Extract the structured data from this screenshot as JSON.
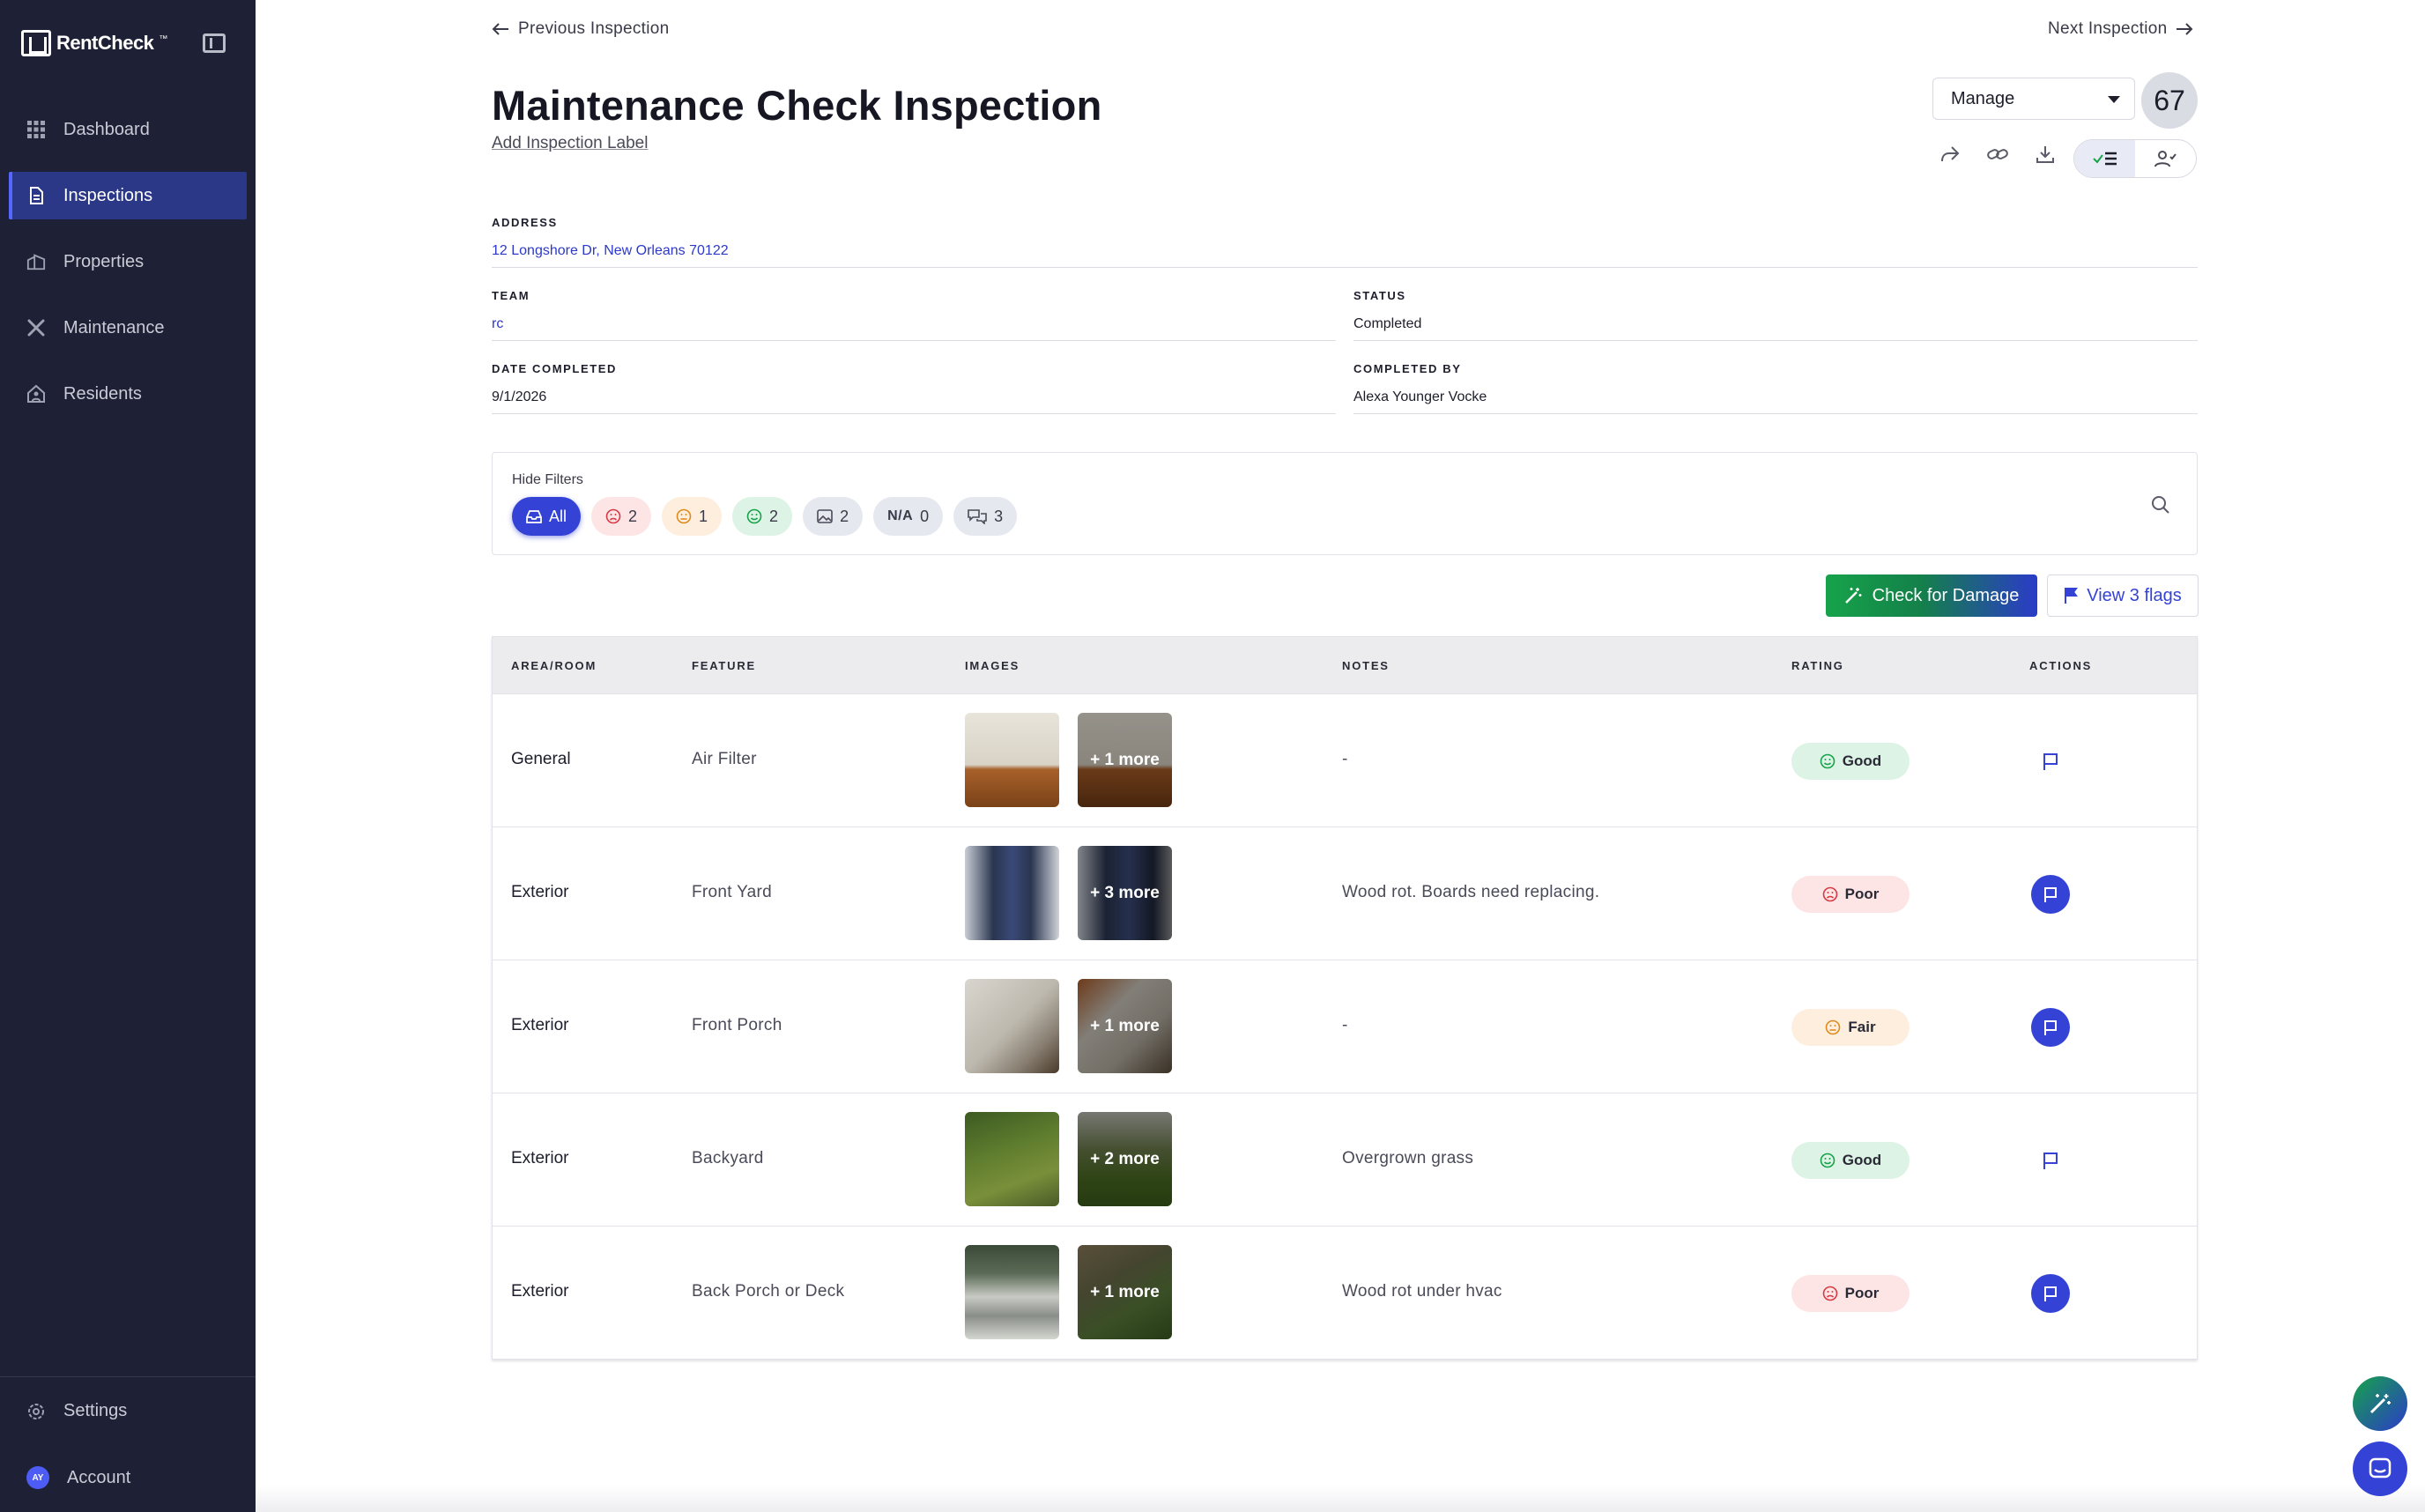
{
  "app": {
    "logo_text": "RentCheck",
    "logo_tm": "™"
  },
  "sidebar": {
    "items": [
      {
        "label": "Dashboard",
        "icon": "grid-icon",
        "active": false
      },
      {
        "label": "Inspections",
        "icon": "document-icon",
        "active": true
      },
      {
        "label": "Properties",
        "icon": "buildings-icon",
        "active": false
      },
      {
        "label": "Maintenance",
        "icon": "tools-icon",
        "active": false
      },
      {
        "label": "Residents",
        "icon": "house-person-icon",
        "active": false
      }
    ],
    "settings_label": "Settings",
    "account_label": "Account",
    "account_initials": "AY"
  },
  "header": {
    "previous_label": "Previous Inspection",
    "next_label": "Next Inspection",
    "title": "Maintenance Check Inspection",
    "add_label": "Add Inspection Label",
    "manage_label": "Manage",
    "score": "67"
  },
  "details": {
    "address_key": "ADDRESS",
    "address_value": "12 Longshore Dr, New Orleans 70122",
    "team_key": "TEAM",
    "team_value": "rc",
    "status_key": "STATUS",
    "status_value": "Completed",
    "date_key": "DATE COMPLETED",
    "date_value": "9/1/2026",
    "completed_by_key": "COMPLETED BY",
    "completed_by_value": "Alexa Younger Vocke"
  },
  "filters": {
    "hide_label": "Hide Filters",
    "all_label": "All",
    "poor_count": "2",
    "fair_count": "1",
    "good_count": "2",
    "images_count": "2",
    "na_label": "N/A",
    "na_count": "0",
    "notes_count": "3"
  },
  "actions": {
    "damage_label": "Check for Damage",
    "flags_label": "View 3 flags"
  },
  "table": {
    "headers": [
      "AREA/ROOM",
      "FEATURE",
      "IMAGES",
      "NOTES",
      "RATING",
      "ACTIONS"
    ],
    "rows": [
      {
        "area": "General",
        "feature": "Air Filter",
        "more": "+ 1 more",
        "notes": "-",
        "rating": "Good",
        "rating_class": "good",
        "flagged": false
      },
      {
        "area": "Exterior",
        "feature": "Front Yard",
        "more": "+ 3 more",
        "notes": "Wood rot. Boards need replacing.",
        "rating": "Poor",
        "rating_class": "poor",
        "flagged": true
      },
      {
        "area": "Exterior",
        "feature": "Front Porch",
        "more": "+ 1 more",
        "notes": "-",
        "rating": "Fair",
        "rating_class": "fair",
        "flagged": true
      },
      {
        "area": "Exterior",
        "feature": "Backyard",
        "more": "+ 2 more",
        "notes": "Overgrown grass",
        "rating": "Good",
        "rating_class": "good",
        "flagged": false
      },
      {
        "area": "Exterior",
        "feature": "Back Porch or Deck",
        "more": "+ 1 more",
        "notes": "Wood rot under hvac",
        "rating": "Poor",
        "rating_class": "poor",
        "flagged": true
      }
    ]
  },
  "colors": {
    "sidebar": "#1e2135",
    "accent": "#3443d6",
    "good": "#ddf3e5",
    "poor": "#fde5e6",
    "fair": "#fdeedd"
  }
}
